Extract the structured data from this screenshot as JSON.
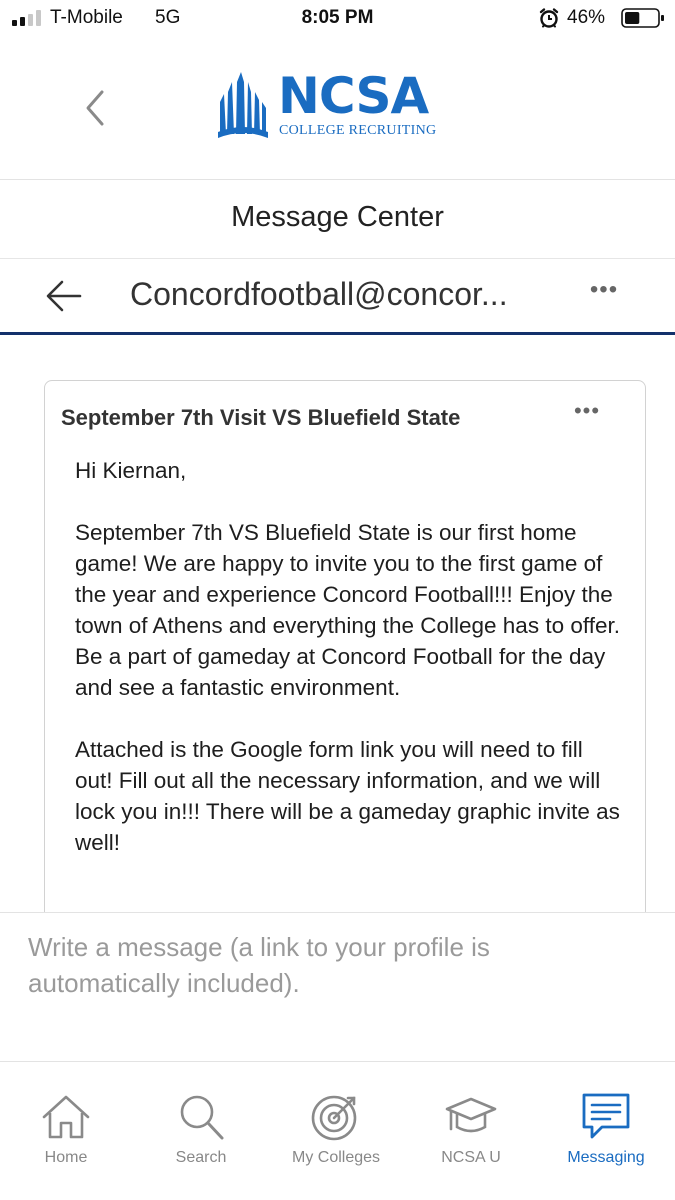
{
  "status_bar": {
    "carrier": "T-Mobile",
    "network": "5G",
    "time": "8:05 PM",
    "battery_percent": "46%",
    "battery_level": 0.46
  },
  "header": {
    "logo_word": "NCSA",
    "logo_subtitle": "COLLEGE RECRUITING"
  },
  "page": {
    "title": "Message Center"
  },
  "conversation": {
    "title": "Concordfootball@concor..."
  },
  "message": {
    "subject": "September 7th Visit VS Bluefield State",
    "greeting": "Hi Kiernan,",
    "paragraph_1": "September 7th VS Bluefield State is our first home game! We are happy to invite you to the first game of the year and experience Concord Football!!! Enjoy the town of Athens and everything the College has to offer. Be a part of gameday at Concord Football for the day and see a fantastic environment.",
    "paragraph_2": "Attached is the Google form link you will need to fill out! Fill out all the necessary information, and we will lock you in!!! There will be a gameday graphic invite as well!"
  },
  "compose": {
    "placeholder": "Write a message (a link to your profile is automatically included).",
    "value": ""
  },
  "nav": {
    "items": [
      {
        "label": "Home",
        "icon": "home-icon",
        "active": false
      },
      {
        "label": "Search",
        "icon": "search-icon",
        "active": false
      },
      {
        "label": "My Colleges",
        "icon": "target-icon",
        "active": false
      },
      {
        "label": "NCSA U",
        "icon": "graduation-cap-icon",
        "active": false
      },
      {
        "label": "Messaging",
        "icon": "chat-icon",
        "active": true
      }
    ]
  },
  "colors": {
    "brand_blue": "#1a6cc1",
    "navy_divider": "#13316b",
    "inactive_gray": "#888888"
  }
}
